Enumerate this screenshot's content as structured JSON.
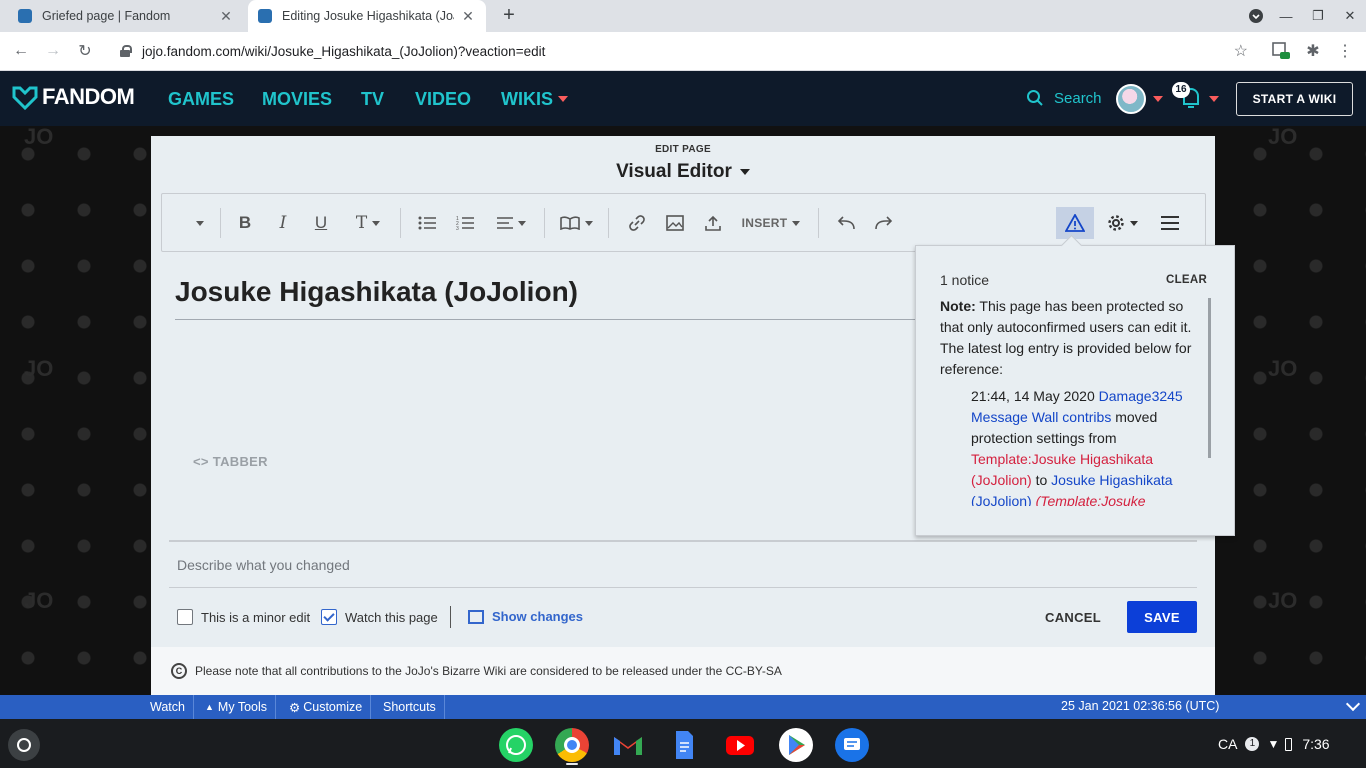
{
  "browser": {
    "tabs": [
      {
        "title": "Griefed page | Fandom"
      },
      {
        "title": "Editing Josuke Higashikata (JoJolion)"
      }
    ],
    "url": "jojo.fandom.com/wiki/Josuke_Higashikata_(JoJolion)?veaction=edit"
  },
  "fandom_nav": {
    "logo": "FANDOM",
    "items": [
      "GAMES",
      "MOVIES",
      "TV",
      "VIDEO",
      "WIKIS"
    ],
    "search_label": "Search",
    "notification_count": "16",
    "start_wiki": "START A WIKI"
  },
  "editor": {
    "kicker": "EDIT PAGE",
    "mode": "Visual Editor",
    "insert_label": "INSERT",
    "page_title": "Josuke Higashikata (JoJolion)",
    "tabber_label": "TABBER",
    "summary_placeholder": "Describe what you changed",
    "minor_edit_label": "This is a minor edit",
    "minor_edit_checked": false,
    "watch_label": "Watch this page",
    "watch_checked": true,
    "show_changes": "Show changes",
    "cancel": "CANCEL",
    "save": "SAVE",
    "license": "Please note that all contributions to the JoJo's Bizarre Wiki are considered to be released under the CC-BY-SA"
  },
  "notice_popup": {
    "count": "1 notice",
    "clear": "CLEAR",
    "note_label": "Note:",
    "note_text": "This page has been protected so that only autoconfirmed users can edit it. The latest log entry is provided below for reference:",
    "log_time": "21:44, 14 May 2020",
    "log_user": "Damage3245",
    "log_wall": "Message Wall",
    "log_contribs": "contribs",
    "log_action": "moved protection settings from",
    "log_from": "Template:Josuke Higashikata (JoJolion)",
    "log_to_word": "to",
    "log_to": "Josuke Higashikata (JoJolion)",
    "log_tail": "(Template:Josuke"
  },
  "wiki_toolbar": {
    "items": [
      "Watch",
      "My Tools",
      "Customize",
      "Shortcuts"
    ],
    "timestamp": "25 Jan 2021 02:36:56 (UTC)"
  },
  "shelf": {
    "apps": [
      "whatsapp-icon",
      "chrome-icon",
      "gmail-icon",
      "docs-icon",
      "youtube-icon",
      "play-store-icon",
      "messages-icon"
    ],
    "ime": "CA",
    "notif": "1",
    "clock": "7:36"
  },
  "colors": {
    "fandom_nav": "#0e1a2a",
    "fandom_accent": "#20c4cc",
    "save_blue": "#0c3fd8",
    "link_blue": "#1446c8",
    "redlink": "#d4213f",
    "wiki_toolbar": "#2a5fc2"
  }
}
